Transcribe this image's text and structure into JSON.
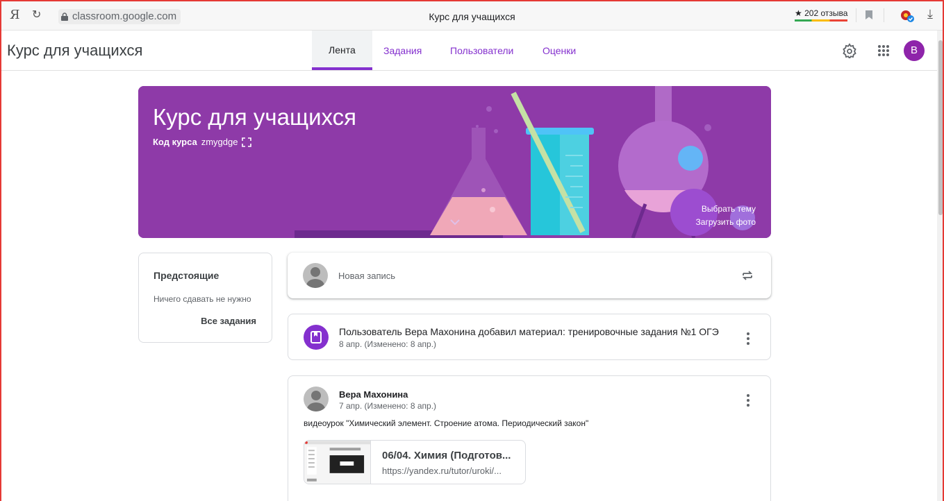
{
  "browser": {
    "url": "classroom.google.com",
    "tab_title": "Курс для учащихся",
    "reviews": "★ 202 отзыва"
  },
  "header": {
    "course_title": "Курс для учащихся",
    "tabs": [
      {
        "label": "Лента",
        "active": true
      },
      {
        "label": "Задания",
        "active": false
      },
      {
        "label": "Пользователи",
        "active": false
      },
      {
        "label": "Оценки",
        "active": false
      }
    ],
    "avatar_letter": "В",
    "accent_color": "#8430ce"
  },
  "banner": {
    "title": "Курс для учащихся",
    "code_label": "Код курса",
    "code_value": "zmygdge",
    "select_theme": "Выбрать тему",
    "upload_photo": "Загрузить фото",
    "color": "#8e3aa8"
  },
  "upcoming": {
    "title": "Предстоящие",
    "empty_text": "Ничего сдавать не нужно",
    "all_link": "Все задания"
  },
  "composer": {
    "placeholder": "Новая запись"
  },
  "stream": [
    {
      "type": "material",
      "text": "Пользователь Вера Махонина добавил материал: тренировочные задания №1 ОГЭ",
      "date": "8 апр. (Изменено: 8 апр.)"
    },
    {
      "type": "post",
      "author": "Вера Махонина",
      "date": "7 апр. (Изменено: 8 апр.)",
      "text": "видеоурок \"Химический элемент. Строение атома. Периодический закон\"",
      "attachment": {
        "title": "06/04. Химия (Подготов...",
        "url": "https://yandex.ru/tutor/uroki/..."
      }
    }
  ]
}
